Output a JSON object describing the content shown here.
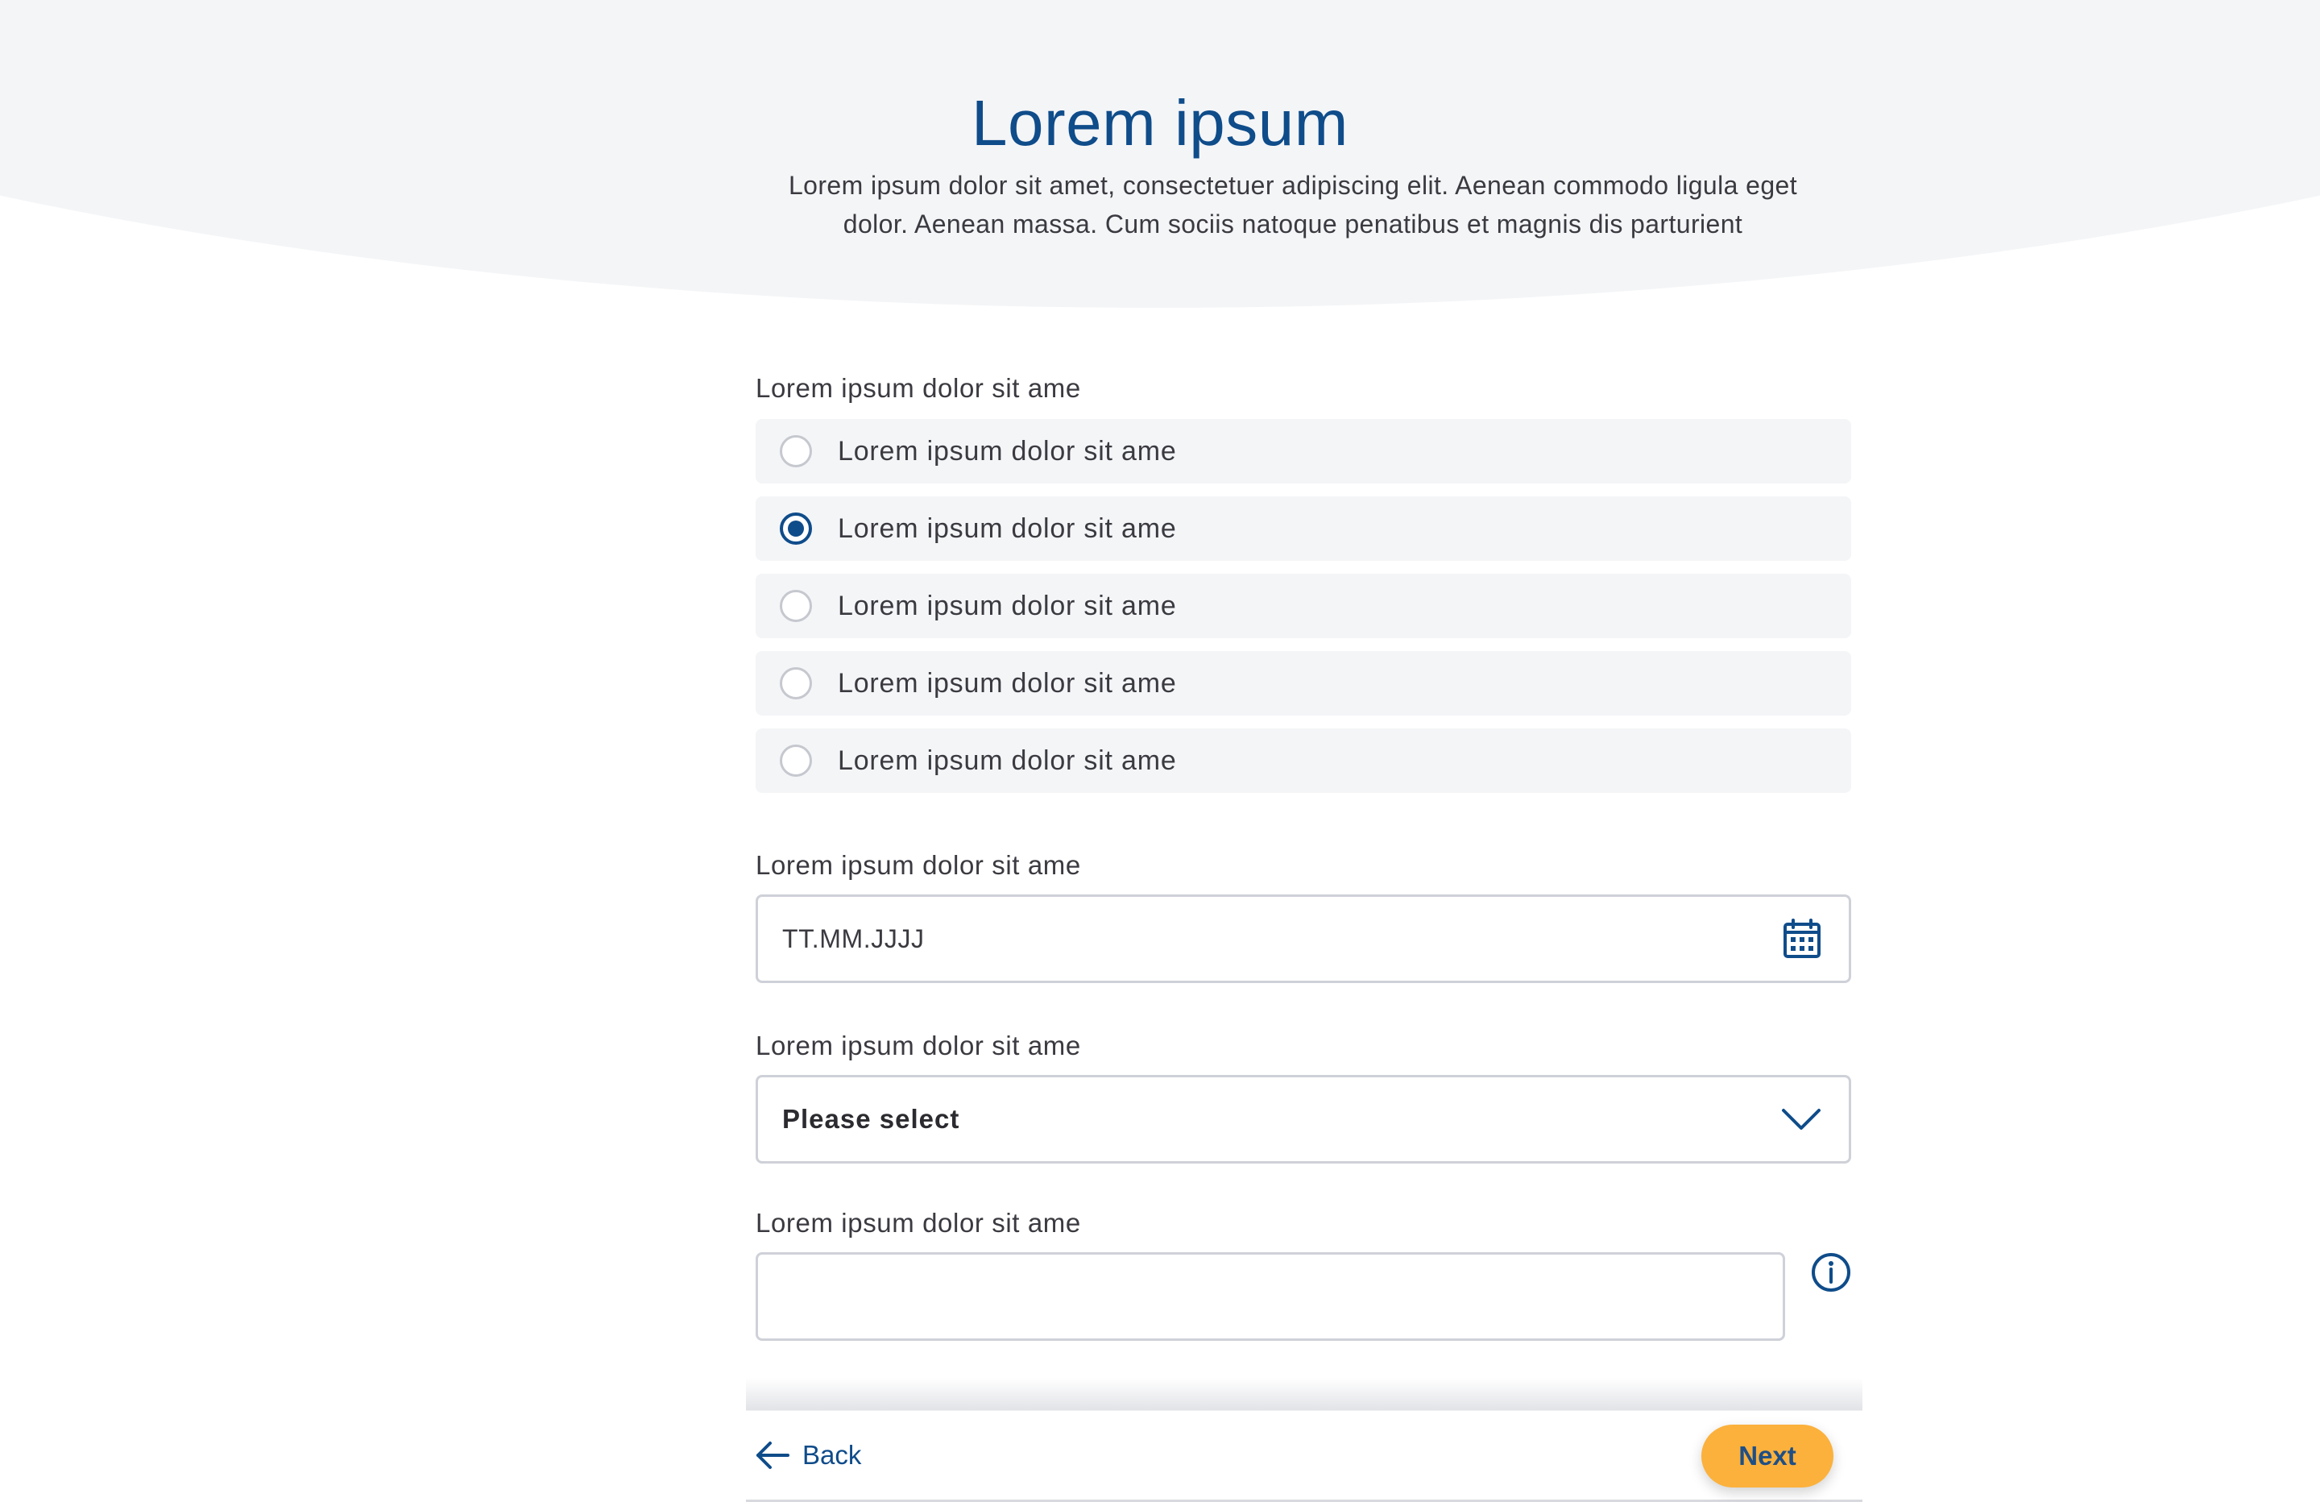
{
  "header": {
    "title": "Lorem ipsum",
    "subtitle": "Lorem ipsum dolor sit amet, consectetuer adipiscing elit. Aenean commodo ligula eget dolor. Aenean massa. Cum sociis natoque penatibus et magnis dis parturient"
  },
  "form": {
    "radio_group": {
      "label": "Lorem ipsum dolor sit ame",
      "options": [
        {
          "label": "Lorem ipsum dolor sit ame",
          "selected": false
        },
        {
          "label": "Lorem ipsum dolor sit ame",
          "selected": true
        },
        {
          "label": "Lorem ipsum dolor sit ame",
          "selected": false
        },
        {
          "label": "Lorem ipsum dolor sit ame",
          "selected": false
        },
        {
          "label": "Lorem ipsum dolor sit ame",
          "selected": false
        }
      ]
    },
    "date_field": {
      "label": "Lorem ipsum dolor sit ame",
      "placeholder": "TT.MM.JJJJ",
      "icon": "calendar-icon"
    },
    "select_field": {
      "label": "Lorem ipsum dolor sit ame",
      "value": "Please select",
      "icon": "chevron-down-icon"
    },
    "text_field": {
      "label": "Lorem ipsum dolor sit ame",
      "value": "",
      "icon": "info-icon"
    }
  },
  "footer": {
    "back_label": "Back",
    "next_label": "Next"
  },
  "colors": {
    "primary": "#0f4c8a",
    "accent": "#fbb13c",
    "band": "#f4f5f7",
    "border": "#cfd1d9"
  }
}
